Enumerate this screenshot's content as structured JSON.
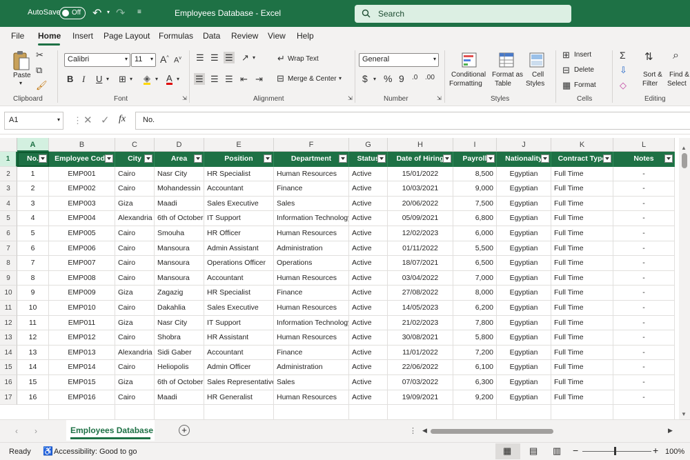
{
  "titlebar": {
    "autosave_label": "AutoSave",
    "autosave_state": "Off",
    "title": "Employees Database  -  Excel",
    "search_placeholder": "Search"
  },
  "tabs": [
    "File",
    "Home",
    "Insert",
    "Page Layout",
    "Formulas",
    "Data",
    "Review",
    "View",
    "Help"
  ],
  "ribbon": {
    "clipboard": {
      "paste": "Paste",
      "label": "Clipboard"
    },
    "font": {
      "name": "Calibri",
      "size": "11",
      "label": "Font",
      "bold": "B",
      "italic": "I",
      "underline": "U"
    },
    "alignment": {
      "wrap": "Wrap Text",
      "merge": "Merge & Center",
      "label": "Alignment"
    },
    "number": {
      "format": "General",
      "label": "Number"
    },
    "styles": {
      "conditional1": "Conditional",
      "conditional2": "Formatting",
      "format_as1": "Format as",
      "format_as2": "Table",
      "cell1": "Cell",
      "cell2": "Styles",
      "label": "Styles"
    },
    "cells": {
      "insert": "Insert",
      "delete": "Delete",
      "format": "Format",
      "label": "Cells"
    },
    "editing": {
      "sort1": "Sort &",
      "sort2": "Filter",
      "find1": "Find &",
      "find2": "Select",
      "label": "Editing"
    }
  },
  "formula_bar": {
    "name_box": "A1",
    "fx": "fx",
    "content": "No."
  },
  "columns": [
    "A",
    "B",
    "C",
    "D",
    "E",
    "F",
    "G",
    "H",
    "I",
    "J",
    "K",
    "L"
  ],
  "headers": [
    "No.",
    "Employee Code",
    "City",
    "Area",
    "Position",
    "Department",
    "Status",
    "Date of Hiring",
    "Payroll",
    "Nationality",
    "Contract Type",
    "Notes"
  ],
  "rows": [
    [
      "1",
      "EMP001",
      "Cairo",
      "Nasr City",
      "HR Specialist",
      "Human Resources",
      "Active",
      "15/01/2022",
      "8,500",
      "Egyptian",
      "Full Time",
      "-"
    ],
    [
      "2",
      "EMP002",
      "Cairo",
      "Mohandessin",
      "Accountant",
      "Finance",
      "Active",
      "10/03/2021",
      "9,000",
      "Egyptian",
      "Full Time",
      "-"
    ],
    [
      "3",
      "EMP003",
      "Giza",
      "Maadi",
      "Sales Executive",
      "Sales",
      "Active",
      "20/06/2022",
      "7,500",
      "Egyptian",
      "Full Time",
      "-"
    ],
    [
      "4",
      "EMP004",
      "Alexandria",
      "6th of October",
      "IT Support",
      "Information Technology",
      "Active",
      "05/09/2021",
      "6,800",
      "Egyptian",
      "Full Time",
      "-"
    ],
    [
      "5",
      "EMP005",
      "Cairo",
      "Smouha",
      "HR Officer",
      "Human Resources",
      "Active",
      "12/02/2023",
      "6,000",
      "Egyptian",
      "Full Time",
      "-"
    ],
    [
      "6",
      "EMP006",
      "Cairo",
      "Mansoura",
      "Admin Assistant",
      "Administration",
      "Active",
      "01/11/2022",
      "5,500",
      "Egyptian",
      "Full Time",
      "-"
    ],
    [
      "7",
      "EMP007",
      "Cairo",
      "Mansoura",
      "Operations Officer",
      "Operations",
      "Active",
      "18/07/2021",
      "6,500",
      "Egyptian",
      "Full Time",
      "-"
    ],
    [
      "8",
      "EMP008",
      "Cairo",
      "Mansoura",
      "Accountant",
      "Human Resources",
      "Active",
      "03/04/2022",
      "7,000",
      "Egyptian",
      "Full Time",
      "-"
    ],
    [
      "9",
      "EMP009",
      "Giza",
      "Zagazig",
      "HR Specialist",
      "Finance",
      "Active",
      "27/08/2022",
      "8,000",
      "Egyptian",
      "Full Time",
      "-"
    ],
    [
      "10",
      "EMP010",
      "Cairo",
      "Dakahlia",
      "Sales Executive",
      "Human Resources",
      "Active",
      "14/05/2023",
      "6,200",
      "Egyptian",
      "Full Time",
      "-"
    ],
    [
      "11",
      "EMP011",
      "Giza",
      "Nasr City",
      "IT Support",
      "Information Technology",
      "Active",
      "21/02/2023",
      "7,800",
      "Egyptian",
      "Full Time",
      "-"
    ],
    [
      "12",
      "EMP012",
      "Cairo",
      "Shobra",
      "HR Assistant",
      "Human Resources",
      "Active",
      "30/08/2021",
      "5,800",
      "Egyptian",
      "Full Time",
      "-"
    ],
    [
      "13",
      "EMP013",
      "Alexandria",
      "Sidi Gaber",
      "Accountant",
      "Finance",
      "Active",
      "11/01/2022",
      "7,200",
      "Egyptian",
      "Full Time",
      "-"
    ],
    [
      "14",
      "EMP014",
      "Cairo",
      "Heliopolis",
      "Admin Officer",
      "Administration",
      "Active",
      "22/06/2022",
      "6,100",
      "Egyptian",
      "Full Time",
      "-"
    ],
    [
      "15",
      "EMP015",
      "Giza",
      "6th of October",
      "Sales Representative",
      "Sales",
      "Active",
      "07/03/2022",
      "6,300",
      "Egyptian",
      "Full Time",
      "-"
    ],
    [
      "16",
      "EMP016",
      "Cairo",
      "Maadi",
      "HR Generalist",
      "Human Resources",
      "Active",
      "19/09/2021",
      "9,200",
      "Egyptian",
      "Full Time",
      "-"
    ]
  ],
  "row_numbers": [
    "1",
    "2",
    "3",
    "4",
    "5",
    "6",
    "7",
    "8",
    "9",
    "10",
    "11",
    "12",
    "13",
    "14",
    "15",
    "16",
    "17"
  ],
  "sheet_tab": "Employees Database",
  "status": {
    "ready": "Ready",
    "accessibility": "Accessibility: Good to go",
    "zoom": "100%"
  },
  "colors": {
    "excel_green": "#1e7145",
    "header_fill": "#1e7145"
  }
}
